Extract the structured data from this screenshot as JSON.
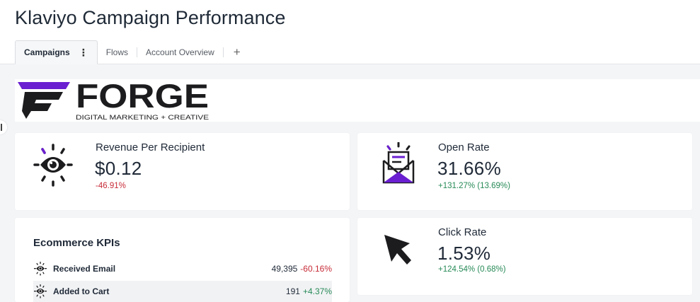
{
  "header": {
    "title": "Klaviyo Campaign Performance",
    "tabs": [
      {
        "label": "Campaigns",
        "active": true
      },
      {
        "label": "Flows",
        "active": false
      },
      {
        "label": "Account Overview",
        "active": false
      }
    ],
    "add_tab_symbol": "+"
  },
  "logo": {
    "name": "FORGE",
    "tagline": "DIGITAL MARKETING + CREATIVE",
    "accent_color": "#6a1fd0",
    "dark_color": "#1c1c1f"
  },
  "kpis": {
    "revenue_per_recipient": {
      "label": "Revenue Per Recipient",
      "value": "$0.12",
      "change": "-46.91%",
      "trend": "negative",
      "icon": "eye-icon"
    },
    "open_rate": {
      "label": "Open Rate",
      "value": "31.66%",
      "change": "+131.27% (13.69%)",
      "trend": "positive",
      "icon": "open-envelope-icon"
    },
    "click_rate": {
      "label": "Click Rate",
      "value": "1.53%",
      "change": "+124.54% (0.68%)",
      "trend": "positive",
      "icon": "cursor-arrow-icon"
    }
  },
  "ecommerce": {
    "title": "Ecommerce KPIs",
    "rows": [
      {
        "label": "Received Email",
        "value": "49,395",
        "change": "-60.16%",
        "trend": "negative",
        "icon": "eye-icon"
      },
      {
        "label": "Added to Cart",
        "value": "191",
        "change": "+4.37%",
        "trend": "positive",
        "icon": "eye-icon"
      }
    ]
  },
  "colors": {
    "negative": "#c72b37",
    "positive": "#278a57",
    "accent": "#6a1fd0"
  }
}
